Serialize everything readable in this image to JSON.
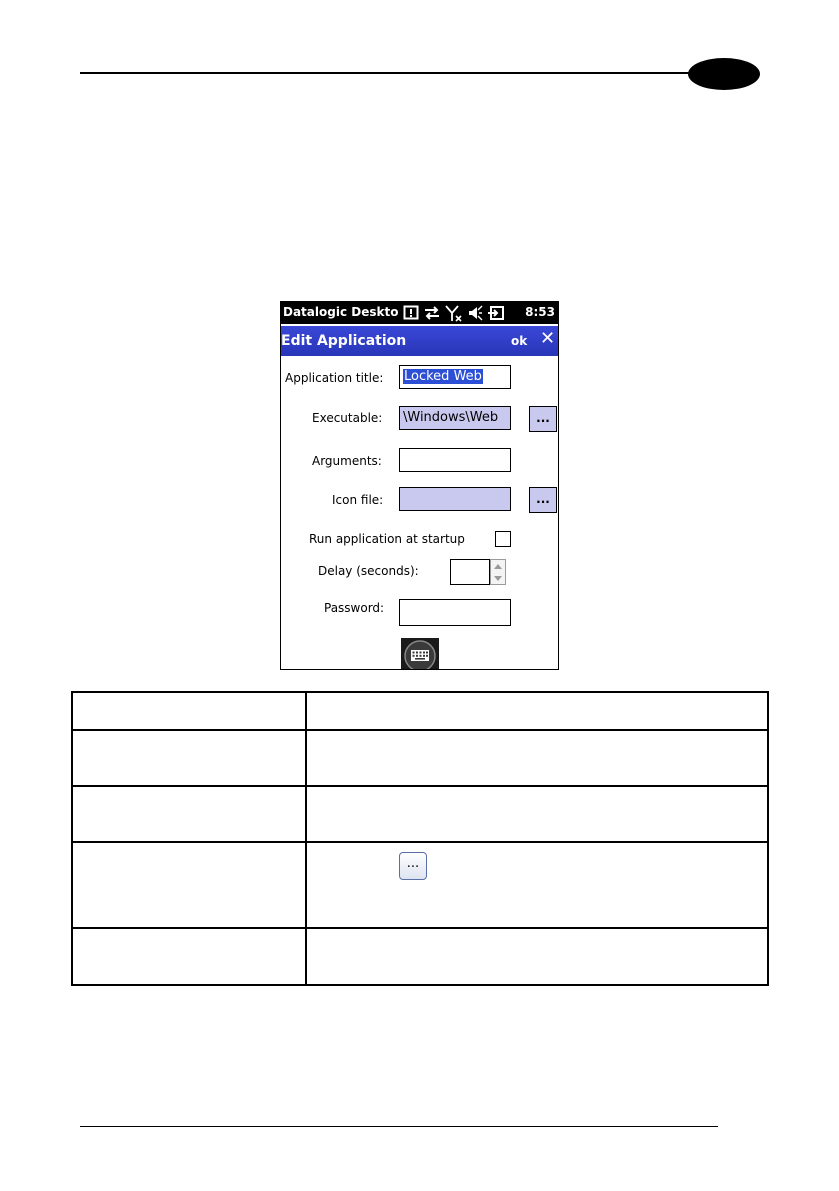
{
  "device": {
    "status_bar": {
      "title": "Datalogic Deskto",
      "time": "8:53"
    },
    "title_bar": {
      "title": "Edit Application",
      "ok": "ok",
      "close": "✕"
    },
    "form": {
      "application_title_label": "Application title:",
      "application_title_value": "Locked Web",
      "executable_label": "Executable:",
      "executable_value": "\\Windows\\Web",
      "arguments_label": "Arguments:",
      "arguments_value": "",
      "icon_file_label": "Icon file:",
      "icon_file_value": "",
      "run_at_startup_label": "Run application at startup",
      "run_at_startup_checked": false,
      "delay_label": "Delay (seconds):",
      "delay_value": "",
      "password_label": "Password:",
      "password_value": "",
      "browse_label": "..."
    },
    "icons": [
      "notification-icon",
      "sync-arrows-icon",
      "no-signal-icon",
      "speaker-muted-icon",
      "battery-charging-icon",
      "keyboard-icon"
    ]
  },
  "table": {
    "browse_button_label": "..."
  }
}
